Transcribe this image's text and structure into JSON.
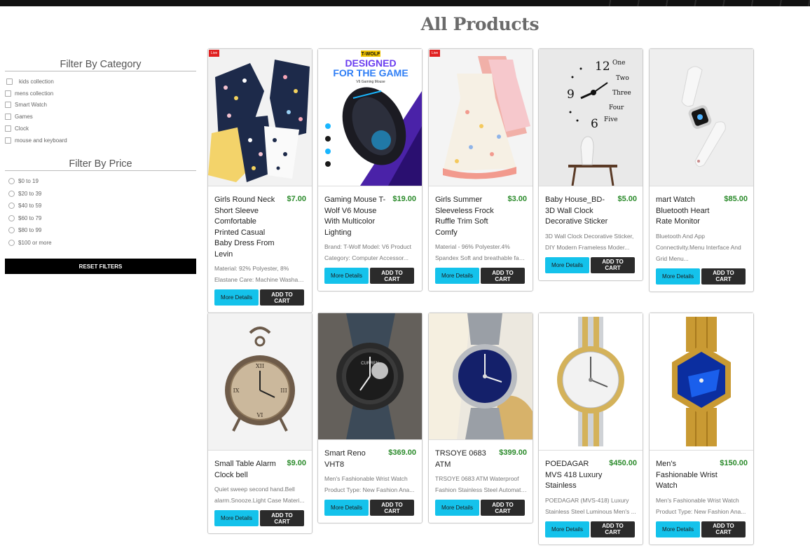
{
  "page": {
    "title": "All Products"
  },
  "filters": {
    "category_title": "Filter By Category",
    "categories": [
      "kids collection",
      "mens collection",
      "Smart Watch",
      "Games",
      "Clock",
      "mouse and keyboard"
    ],
    "price_title": "Filter By Price",
    "prices": [
      "$0 to 19",
      "$20 to 39",
      "$40 to 59",
      "$60 to 79",
      "$80 to 99",
      "$100 or more"
    ],
    "reset_label": "RESET FILTERS"
  },
  "buttons": {
    "more": "More Details",
    "cart": "ADD TO CART"
  },
  "badge": {
    "live": "Live"
  },
  "products": [
    {
      "name": "Girls Round Neck Short Sleeve Comfortable Printed Casual Baby Dress From Levin",
      "price": "$7.00",
      "desc1": "Material: 92% Polyester, 8%",
      "desc2": "Elastane Care: Machine Washable...",
      "icon": "baby-dress-image",
      "live": true
    },
    {
      "name": "Gaming Mouse T-Wolf V6 Mouse With Multicolor Lighting",
      "price": "$19.00",
      "desc1": "Brand: T-Wolf Model: V6 Product",
      "desc2": "Category: Computer Accessor...",
      "icon": "gaming-mouse-image",
      "live": false,
      "img_brand": "T-WOLF",
      "img_headline1": "DESIGNED",
      "img_headline2": "FOR THE GAME",
      "img_sub": "V6 Gaming Mouse"
    },
    {
      "name": "Girls Summer Sleeveless Frock Ruffle Trim Soft Comfy",
      "price": "$3.00",
      "desc1": "Material - 96% Polyester.4%",
      "desc2": "Spandex Soft and breathable fabr...",
      "icon": "frock-image",
      "live": true
    },
    {
      "name": "Baby House_BD-3D Wall Clock Decorative Sticker",
      "price": "$5.00",
      "desc1": "3D Wall Clock Decorative Sticker,",
      "desc2": "DIY Modern Frameless Moder...",
      "icon": "wall-clock-image",
      "live": false,
      "img_words": [
        "12",
        "One",
        "Two",
        "Three",
        "Four",
        "Five",
        "9",
        "6"
      ]
    },
    {
      "name": "mart Watch Bluetooth Heart Rate Monitor",
      "price": "$85.00",
      "desc1": "Bluetooth And App",
      "desc2": "Connectivity.Menu Interface And",
      "desc3": "Grid Menu...",
      "icon": "smart-watch-image",
      "live": false
    },
    {
      "name": "Small Table Alarm Clock bell",
      "price": "$9.00",
      "desc1": "Quiet sweep second hand.Bell",
      "desc2": "alarm.Snooze.Light Case Materi...",
      "icon": "alarm-clock-image",
      "live": false
    },
    {
      "name": "Smart Reno VHT8",
      "price": "$369.00",
      "desc1": "Men's Fashionable Wrist Watch",
      "desc2": "Product Type: New Fashion Ana...",
      "icon": "curren-watch-image",
      "live": false,
      "img_brand": "CURREN"
    },
    {
      "name": "TRSOYE 0683 ATM",
      "price": "$399.00",
      "desc1": "TRSOYE 0683 ATM Waterproof",
      "desc2": "Fashion Stainless Steel Automatic...",
      "icon": "trsoye-watch-image",
      "live": false
    },
    {
      "name": "POEDAGAR MVS 418 Luxury Stainless",
      "price": "$450.00",
      "desc1": "POEDAGAR (MVS-418) Luxury",
      "desc2": "Stainless Steel Luminous Men's ...",
      "icon": "poedagar-watch-image",
      "live": false
    },
    {
      "name": "Men's Fashionable Wrist Watch",
      "price": "$150.00",
      "desc1": "Men's Fashionable Wrist Watch",
      "desc2": "Product Type: New Fashion Ana...",
      "icon": "gold-blue-watch-image",
      "live": false
    }
  ]
}
